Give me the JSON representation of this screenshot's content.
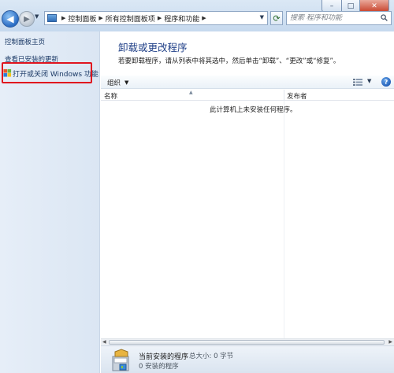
{
  "window": {
    "minimize_glyph": "–",
    "maximize_glyph": "□",
    "close_glyph": "✕"
  },
  "nav": {
    "back_glyph": "◀",
    "forward_glyph": "▶"
  },
  "address_bar": {
    "breadcrumbs": [
      "控制面板",
      "所有控制面板项",
      "程序和功能"
    ],
    "icon": "control-panel-icon"
  },
  "search": {
    "placeholder": "搜索 程序和功能",
    "icon": "search-icon"
  },
  "left_pane": {
    "links": [
      "控制面板主页",
      "查看已安装的更新",
      "打开或关闭 Windows 功能"
    ],
    "highlight_color": "#e0141e"
  },
  "content": {
    "heading": "卸载或更改程序",
    "description": "若要卸载程序，请从列表中将其选中，然后单击“卸载”、“更改”或“修复”。"
  },
  "toolbar": {
    "organize_label": "组织",
    "help_glyph": "?"
  },
  "columns": {
    "name": "名称",
    "publisher": "发布者"
  },
  "list": {
    "empty_message": "此计算机上未安装任何程序。"
  },
  "status": {
    "title": "当前安装的程序",
    "size_text": "总大小: 0 字节",
    "count_text": "0 安装的程序"
  },
  "colors": {
    "heading": "#1f3f87",
    "link": "#1c3a66",
    "left_pane_bg": "#dfe8f4"
  }
}
